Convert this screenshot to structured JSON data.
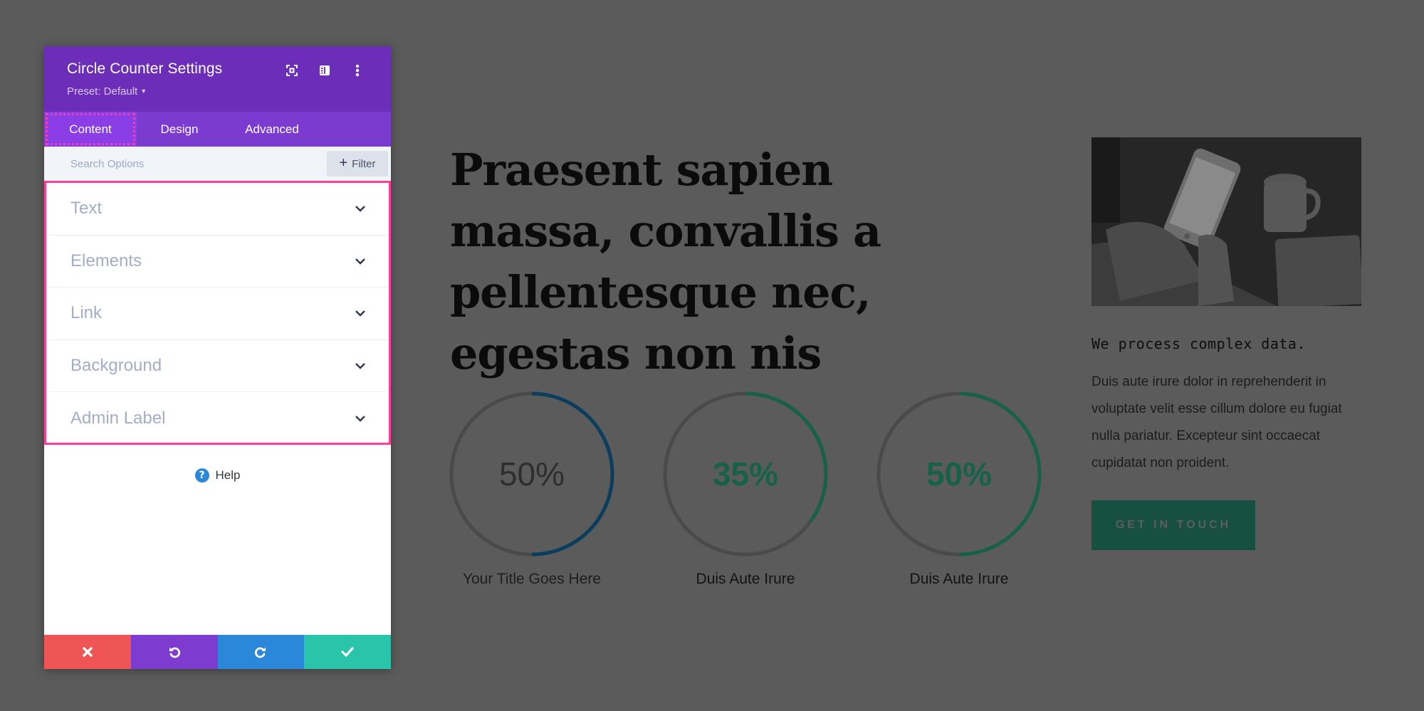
{
  "panel": {
    "title": "Circle Counter Settings",
    "preset_label": "Preset: Default",
    "header_icons": [
      "fullscreen-icon",
      "split-view-icon",
      "more-options-icon"
    ],
    "tabs": [
      {
        "label": "Content",
        "active": true
      },
      {
        "label": "Design",
        "active": false
      },
      {
        "label": "Advanced",
        "active": false
      }
    ],
    "search": {
      "placeholder": "Search Options",
      "value": ""
    },
    "filter_label": "Filter",
    "toggles": [
      {
        "label": "Text"
      },
      {
        "label": "Elements"
      },
      {
        "label": "Link"
      },
      {
        "label": "Background"
      },
      {
        "label": "Admin Label"
      }
    ],
    "help_label": "Help",
    "actions": [
      {
        "name": "discard",
        "icon": "close-icon",
        "color": "#ef5555"
      },
      {
        "name": "undo",
        "icon": "undo-icon",
        "color": "#7e3bd0"
      },
      {
        "name": "redo",
        "icon": "redo-icon",
        "color": "#2b87da"
      },
      {
        "name": "save",
        "icon": "check-icon",
        "color": "#29c4a9"
      }
    ],
    "colors": {
      "header": "#6c2eb9",
      "tabs": "#7b3bd0",
      "active_tab": "#8b3ee6",
      "highlight": "#ff3d9a"
    }
  },
  "page": {
    "headline": "Praesent sapien massa, convallis a pellentesque nec, egestas non nis",
    "counters": [
      {
        "percent": 50,
        "label": "50%",
        "title": "Your Title Goes Here",
        "bar_color": "#0b3d5e",
        "track_color": "#4a4a4a"
      },
      {
        "percent": 35,
        "label": "35%",
        "title": "Duis Aute Irure",
        "bar_color": "#17614a",
        "track_color": "#4a4a4a"
      },
      {
        "percent": 50,
        "label": "50%",
        "title": "Duis Aute Irure",
        "bar_color": "#17614a",
        "track_color": "#4a4a4a"
      }
    ],
    "side_image_alt": "Hands holding a smartphone next to a coffee mug and laptop",
    "side_heading": "We process complex data.",
    "side_body": "Duis aute irure dolor in reprehenderit in voluptate velit esse cillum dolore eu fugiat nulla pariatur. Excepteur sint occaecat cupidatat non proident.",
    "cta_label": "GET IN TOUCH",
    "cta_color": "#174f40",
    "overlay_color": "#5b5b5b"
  }
}
